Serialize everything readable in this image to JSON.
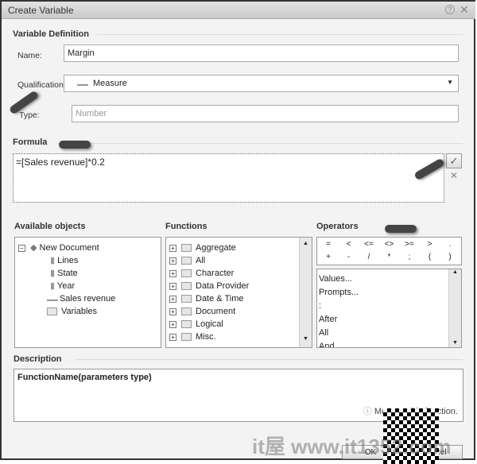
{
  "window": {
    "title": "Create Variable",
    "help_icon": "help-icon",
    "close_icon": "close-icon"
  },
  "definition": {
    "section": "Variable Definition",
    "name_label": "Name:",
    "name_value": "Margin",
    "qual_label": "Qualification:",
    "qual_value": "Measure",
    "type_label": "Type:",
    "type_placeholder": "Number"
  },
  "formula": {
    "section": "Formula",
    "value": "=[Sales revenue]*0.2"
  },
  "objects": {
    "section": "Available objects",
    "root": "New Document",
    "items": [
      "Lines",
      "State",
      "Year",
      "Sales revenue",
      "Variables"
    ]
  },
  "functions": {
    "section": "Functions",
    "items": [
      "Aggregate",
      "All",
      "Character",
      "Data Provider",
      "Date & Time",
      "Document",
      "Logical",
      "Misc."
    ]
  },
  "operators": {
    "section": "Operators",
    "symbols": [
      "=",
      "<",
      "<=",
      "<>",
      ">=",
      ">",
      ".",
      "+",
      "-",
      "/",
      "*",
      ";",
      "(",
      ")"
    ],
    "items": [
      "Values...",
      "Prompts...",
      ":",
      "After",
      "All",
      "And"
    ]
  },
  "description": {
    "section": "Description",
    "text": "FunctionName(parameters type)",
    "more": "More on this function."
  },
  "buttons": {
    "ok": "OK",
    "cancel": "Cancel"
  },
  "watermark": "it屋 www.it1352.com"
}
